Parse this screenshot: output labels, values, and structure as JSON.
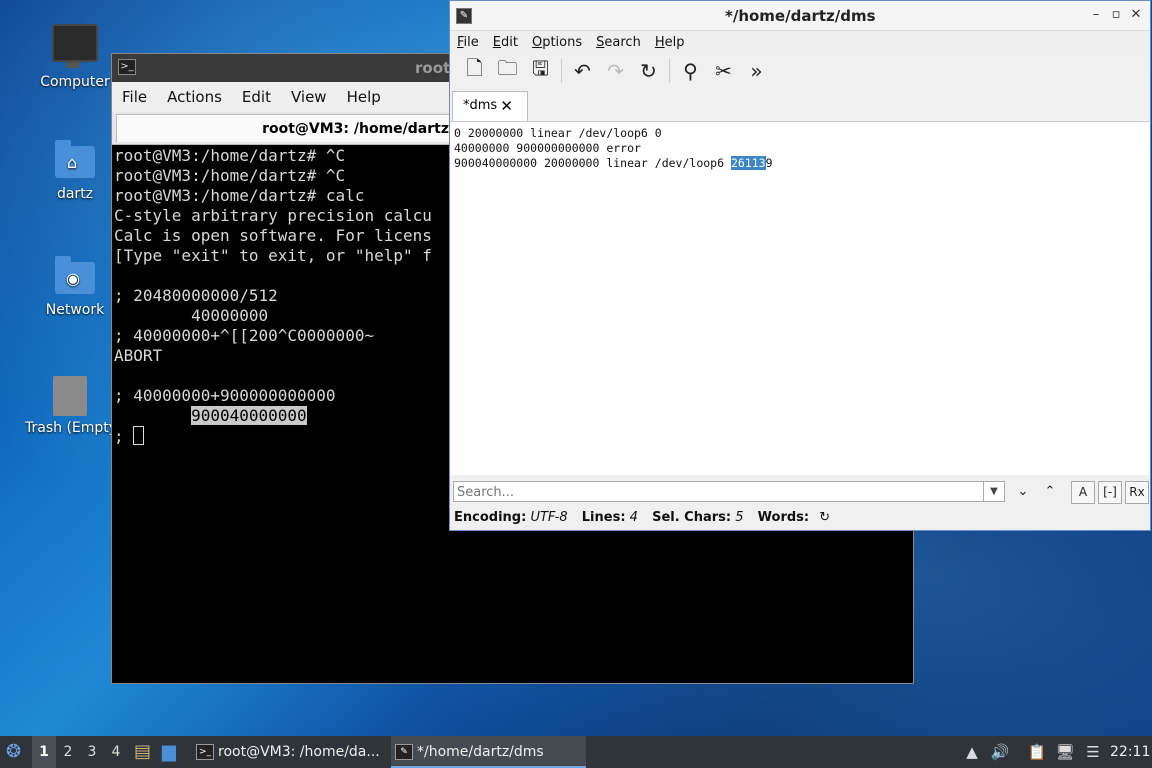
{
  "desktop": {
    "icons": [
      {
        "label": "Computer"
      },
      {
        "label": "dartz"
      },
      {
        "label": "Network"
      },
      {
        "label": "Trash (Empty)"
      }
    ]
  },
  "terminal": {
    "title": "root",
    "menu": [
      "File",
      "Actions",
      "Edit",
      "View",
      "Help"
    ],
    "tab_title": "root@VM3: /home/dartz",
    "lines": [
      "root@VM3:/home/dartz# ^C",
      "root@VM3:/home/dartz# ^C",
      "root@VM3:/home/dartz# calc",
      "C-style arbitrary precision calcu",
      "Calc is open software. For licens",
      "[Type \"exit\" to exit, or \"help\" f",
      "",
      "; 20480000000/512",
      "        40000000",
      "; 40000000+^[[200^C0000000~",
      "ABORT",
      "",
      "; 40000000+900000000000"
    ],
    "result_indent": "        ",
    "result": "900040000000",
    "prompt": "; "
  },
  "editor": {
    "title": "*/home/dartz/dms",
    "window_buttons": [
      "–",
      "▫",
      "✕"
    ],
    "menu": [
      "File",
      "Edit",
      "Options",
      "Search",
      "Help"
    ],
    "toolbar": [
      "new-document",
      "open",
      "save",
      "undo",
      "redo",
      "reload",
      "find",
      "find-replace",
      "more"
    ],
    "tab_label": "*dms",
    "text_lines": [
      "0 20000000 linear /dev/loop6 0",
      "40000000 900000000000 error"
    ],
    "line3_prefix": "900040000000 20000000 linear /dev/loop6 ",
    "line3_selected": "26113",
    "line3_suffix": "9",
    "search_placeholder": "Search...",
    "search_buttons": [
      "A",
      "[-]",
      "Rx"
    ],
    "status": {
      "encoding_label": "Encoding:",
      "encoding_value": "UTF-8",
      "lines_label": "Lines:",
      "lines_value": "4",
      "sel_label": "Sel. Chars:",
      "sel_value": "5",
      "words_label": "Words:"
    }
  },
  "taskbar": {
    "workspaces": [
      "1",
      "2",
      "3",
      "4"
    ],
    "tasks": [
      {
        "label": "root@VM3: /home/da..."
      },
      {
        "label": "*/home/dartz/dms"
      }
    ],
    "clock": "22:11"
  }
}
